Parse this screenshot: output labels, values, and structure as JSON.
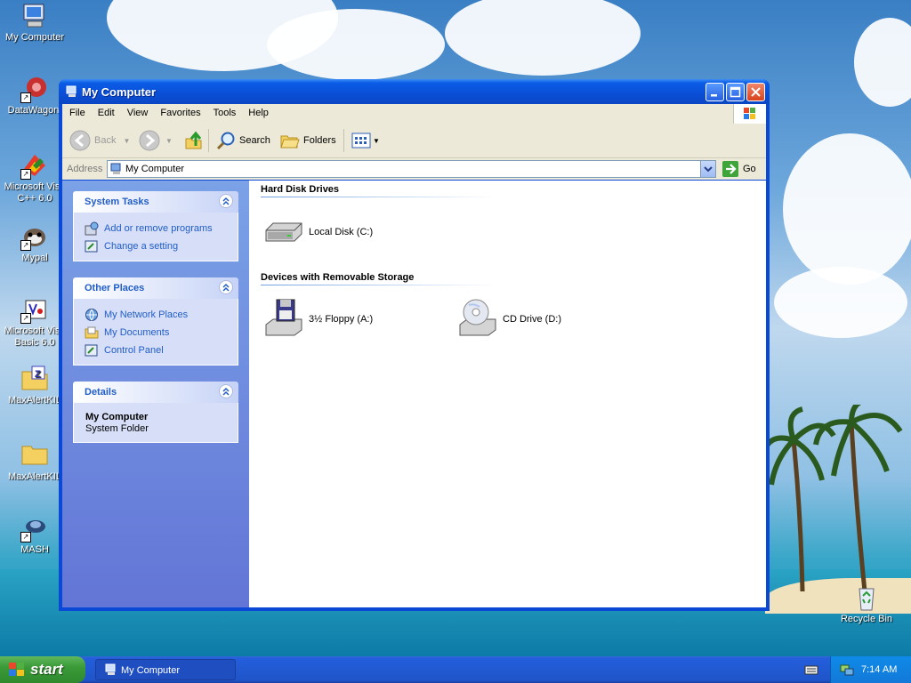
{
  "desktop": {
    "icons": [
      {
        "label": "My Computer",
        "icon": "computer-icon"
      },
      {
        "label": "DataWagon.",
        "icon": "datawagon-icon"
      },
      {
        "label": "Microsoft Visu",
        "label2": "C++ 6.0",
        "icon": "visual-cpp-icon"
      },
      {
        "label": "Mypal",
        "icon": "mypal-icon"
      },
      {
        "label": "Microsoft Visu",
        "label2": "Basic 6.0",
        "icon": "visual-basic-icon"
      },
      {
        "label": "MaxAlertKIL",
        "icon": "zip-folder-icon"
      },
      {
        "label": "MaxAlertKIL",
        "icon": "folder-icon"
      },
      {
        "label": "MASH",
        "icon": "mash-icon"
      },
      {
        "label": "Recycle Bin",
        "icon": "recycle-bin-icon"
      }
    ]
  },
  "window": {
    "title": "My Computer",
    "menu": [
      "File",
      "Edit",
      "View",
      "Favorites",
      "Tools",
      "Help"
    ],
    "toolbar": {
      "back": "Back",
      "search": "Search",
      "folders": "Folders"
    },
    "address": {
      "label": "Address",
      "value": "My Computer",
      "go": "Go"
    }
  },
  "sidebar": {
    "system_tasks": {
      "title": "System Tasks",
      "items": [
        "Add or remove programs",
        "Change a setting"
      ]
    },
    "other_places": {
      "title": "Other Places",
      "items": [
        "My Network Places",
        "My Documents",
        "Control Panel"
      ]
    },
    "details": {
      "title": "Details",
      "name": "My Computer",
      "type": "System Folder"
    }
  },
  "content": {
    "hard_disk": {
      "title": "Hard Disk Drives",
      "drives": [
        "Local Disk (C:)"
      ]
    },
    "removable": {
      "title": "Devices with Removable Storage",
      "drives": [
        "3½ Floppy (A:)",
        "CD Drive (D:)"
      ]
    }
  },
  "taskbar": {
    "start": "start",
    "task": "My Computer",
    "clock": "7:14 AM"
  }
}
